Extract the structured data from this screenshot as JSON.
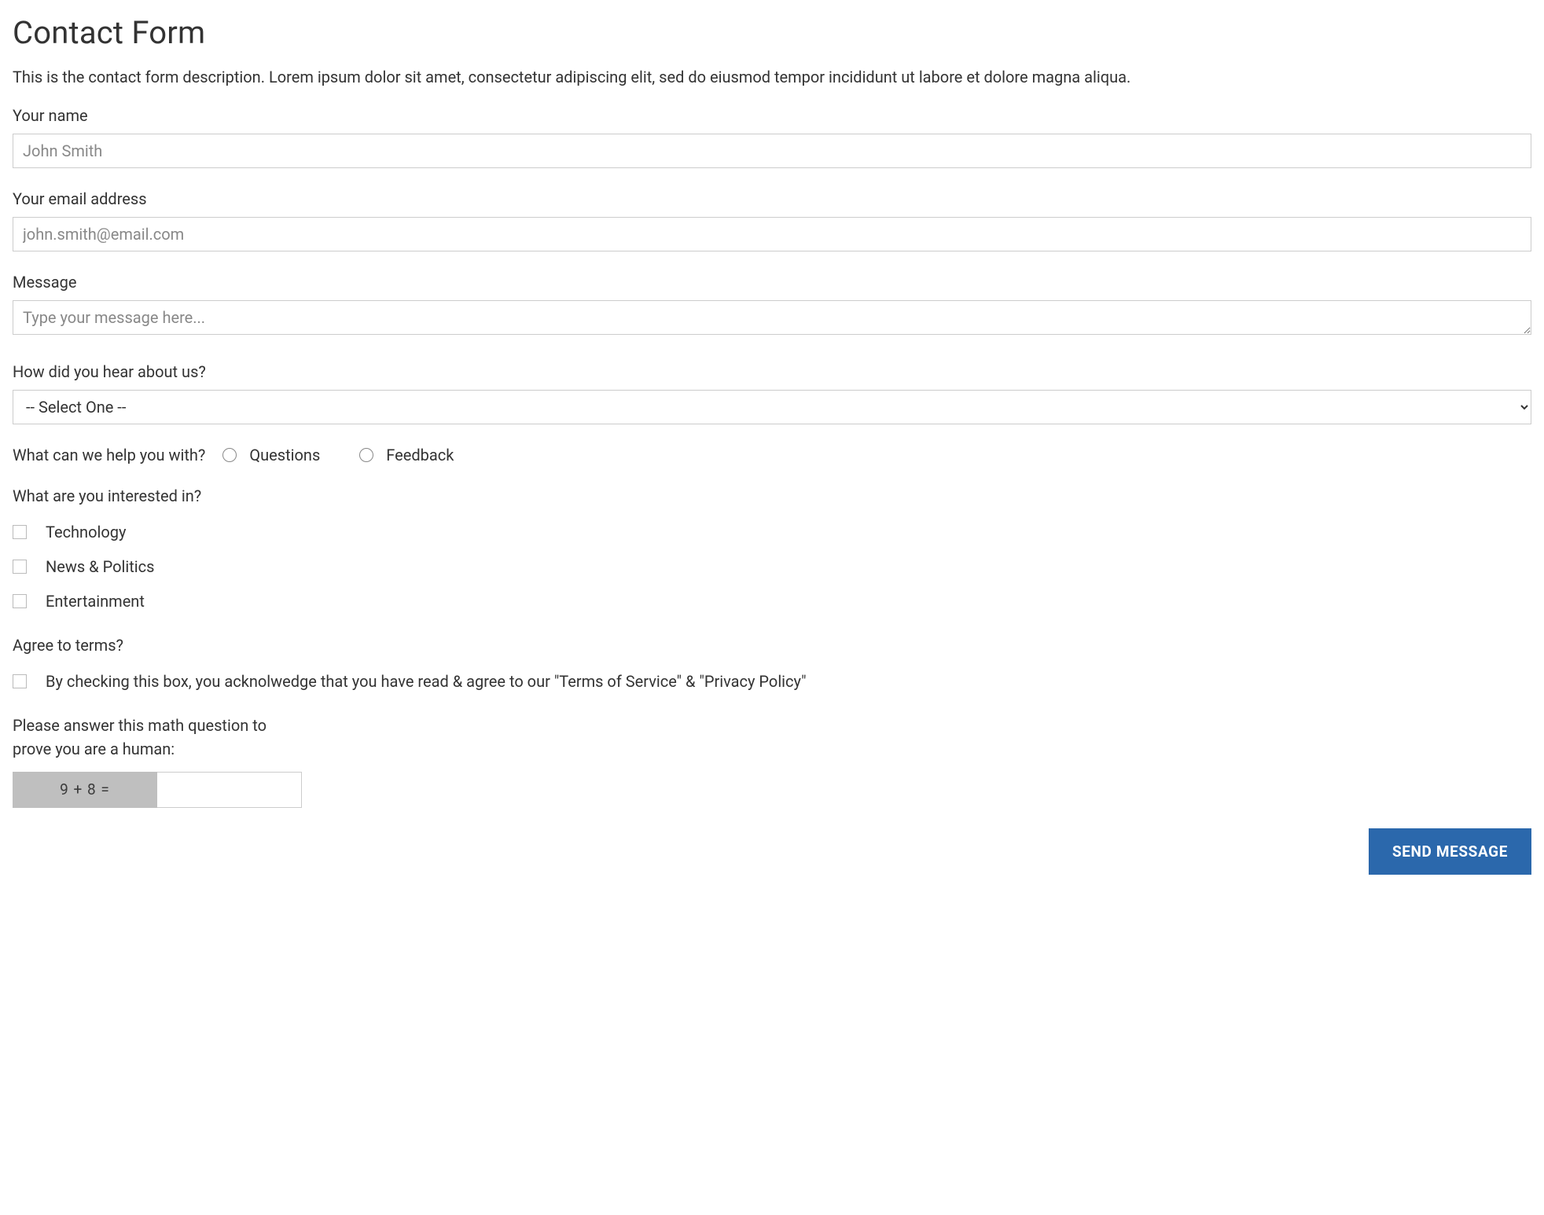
{
  "form": {
    "title": "Contact Form",
    "description": "This is the contact form description. Lorem ipsum dolor sit amet, consectetur adipiscing elit, sed do eiusmod tempor incididunt ut labore et dolore magna aliqua.",
    "name": {
      "label": "Your name",
      "placeholder": "John Smith",
      "value": ""
    },
    "email": {
      "label": "Your email address",
      "placeholder": "john.smith@email.com",
      "value": ""
    },
    "message": {
      "label": "Message",
      "placeholder": "Type your message here...",
      "value": ""
    },
    "hear_about": {
      "label": "How did you hear about us?",
      "selected": "-- Select One --"
    },
    "help_with": {
      "label": "What can we help you with?",
      "options": [
        "Questions",
        "Feedback"
      ]
    },
    "interests": {
      "label": "What are you interested in?",
      "options": [
        "Technology",
        "News & Politics",
        "Entertainment"
      ]
    },
    "terms": {
      "label": "Agree to terms?",
      "text": "By checking this box, you acknolwedge that you have read & agree to our \"Terms of Service\" & \"Privacy Policy\""
    },
    "captcha": {
      "label": "Please answer this math question to prove you are a human:",
      "question": "9 + 8 =",
      "value": ""
    },
    "submit_label": "SEND MESSAGE"
  }
}
